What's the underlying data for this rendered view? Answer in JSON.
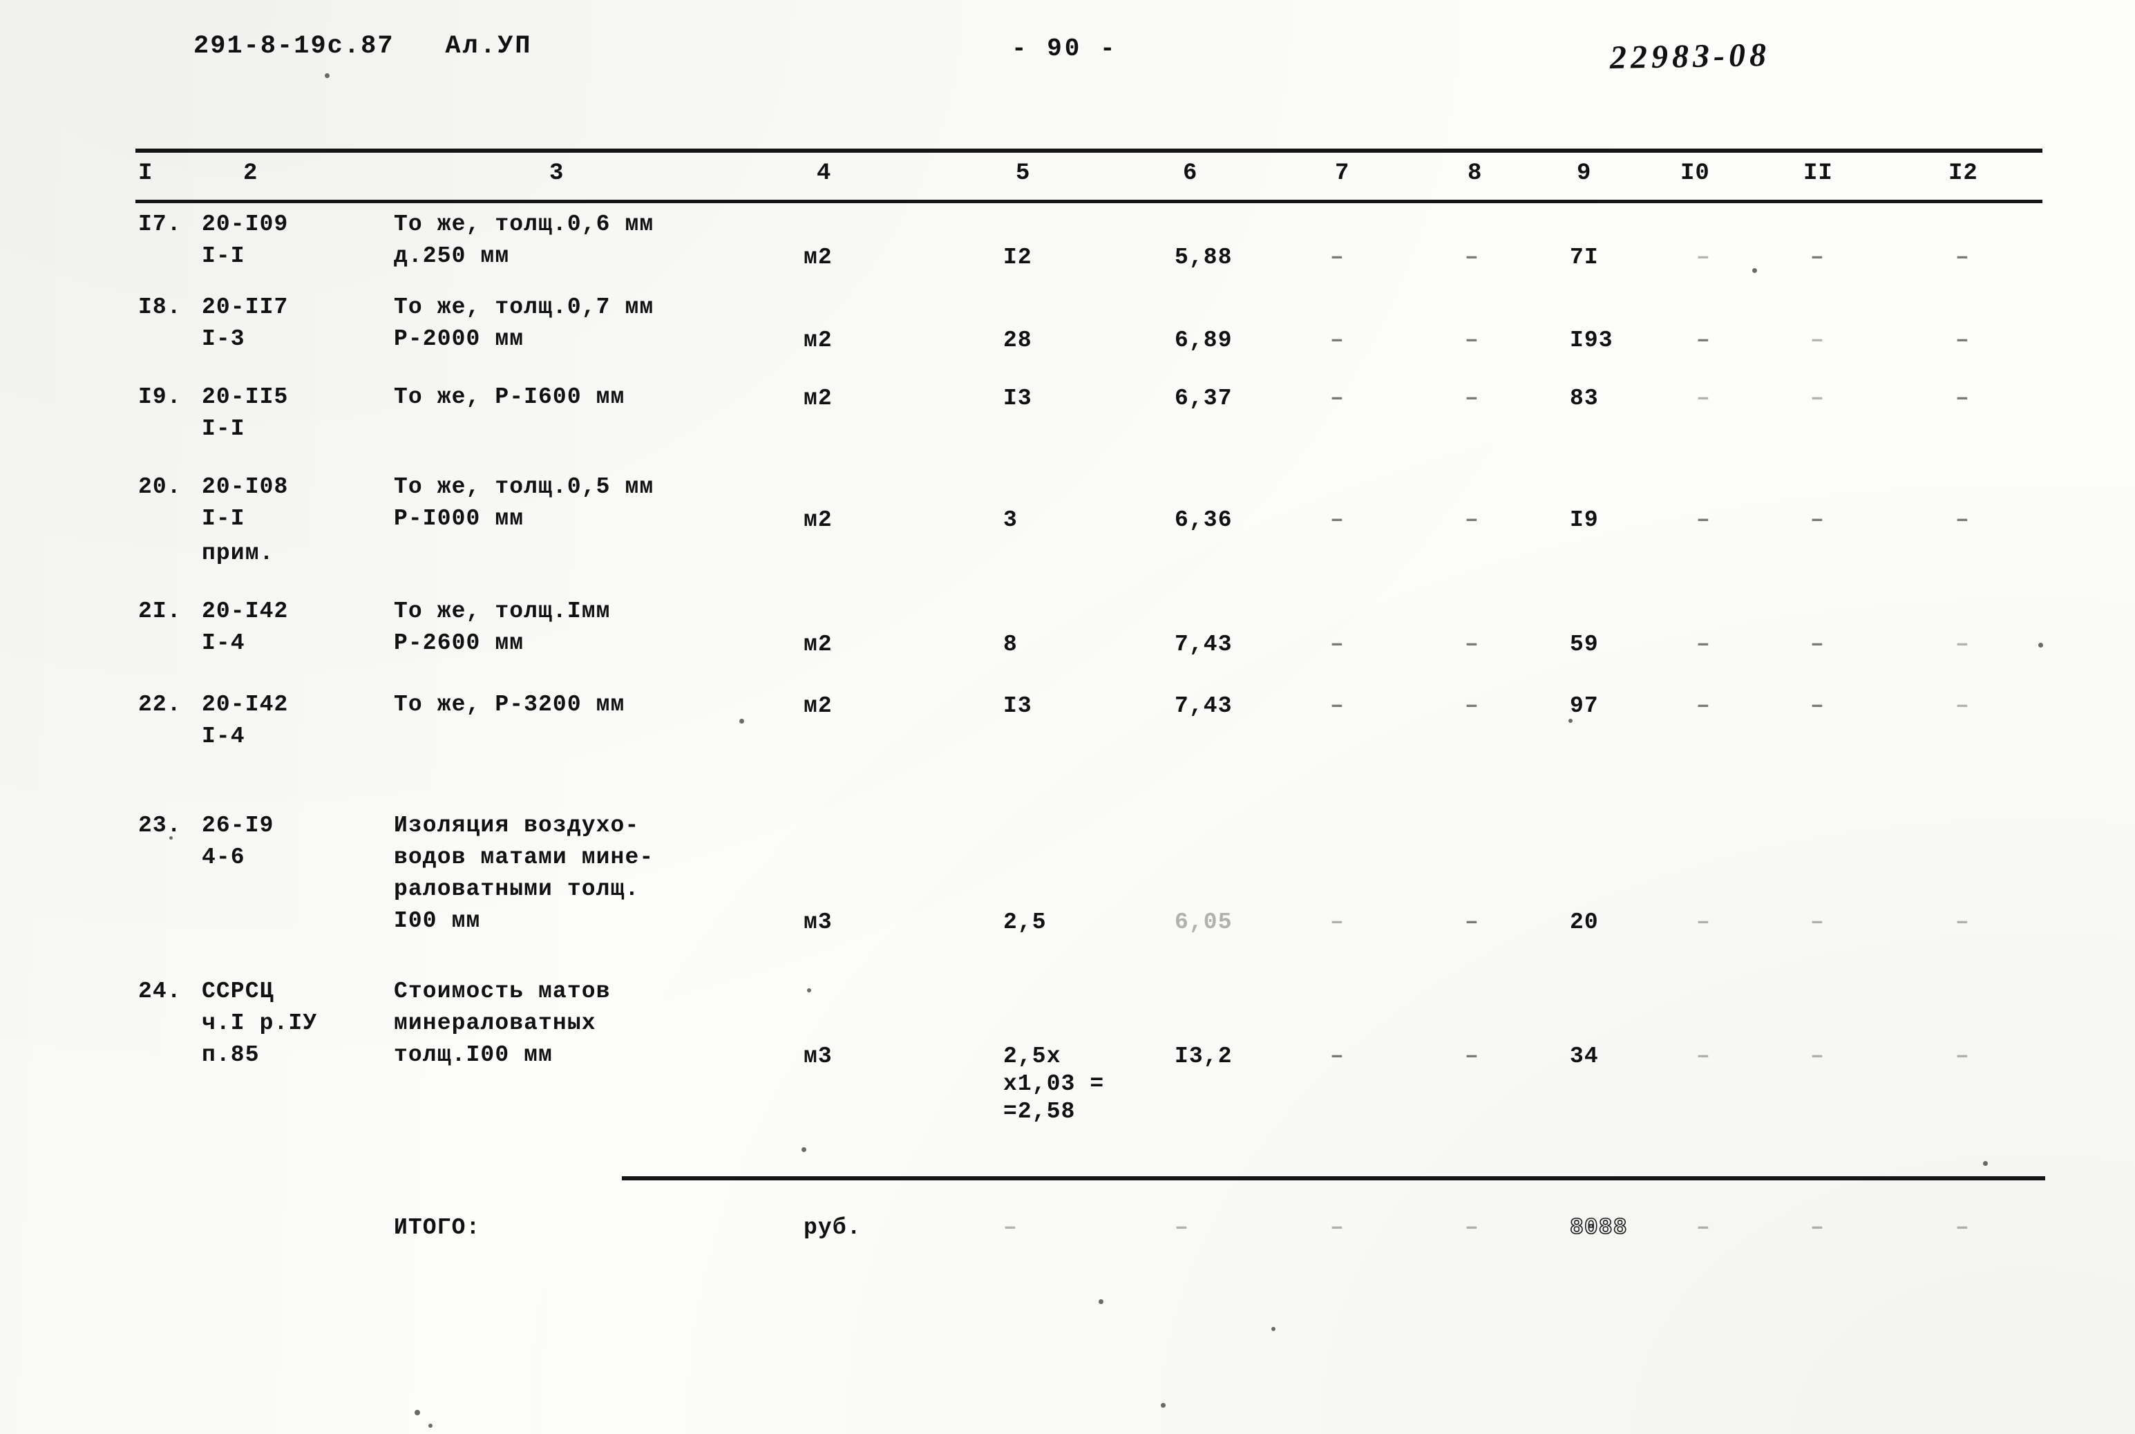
{
  "header": {
    "doc_code": "291-8-19с.87",
    "album": "Ал.УП",
    "page_label": "- 90 -",
    "archive_code": "22983-08"
  },
  "table": {
    "column_headers": [
      "I",
      "2",
      "3",
      "4",
      "5",
      "6",
      "7",
      "8",
      "9",
      "I0",
      "II",
      "I2"
    ],
    "dash": "–",
    "rows": [
      {
        "num": "I7.",
        "code_line1": "20-I09",
        "code_line2": "I-I",
        "code_line3": "",
        "desc_line1": "То же, толщ.0,6 мм",
        "desc_line2": "д.250 мм",
        "desc_line3": "",
        "desc_line4": "",
        "unit": "м2",
        "qty": "I2",
        "price": "5,88",
        "c7": "–",
        "c8": "–",
        "c9": "7I",
        "c10": "–",
        "c11": "–",
        "c12": "–"
      },
      {
        "num": "I8.",
        "code_line1": "20-II7",
        "code_line2": "I-3",
        "code_line3": "",
        "desc_line1": "То же, толщ.0,7 мм",
        "desc_line2": "Р-2000 мм",
        "desc_line3": "",
        "desc_line4": "",
        "unit": "м2",
        "qty": "28",
        "price": "6,89",
        "c7": "–",
        "c8": "–",
        "c9": "I93",
        "c10": "–",
        "c11": "–",
        "c12": "–"
      },
      {
        "num": "I9.",
        "code_line1": "20-II5",
        "code_line2": "I-I",
        "code_line3": "",
        "desc_line1": "То же, Р-I600 мм",
        "desc_line2": "",
        "desc_line3": "",
        "desc_line4": "",
        "unit": "м2",
        "qty": "I3",
        "price": "6,37",
        "c7": "–",
        "c8": "–",
        "c9": "83",
        "c10": "–",
        "c11": "–",
        "c12": "–"
      },
      {
        "num": "20.",
        "code_line1": "20-I08",
        "code_line2": "I-I",
        "code_line3": "прим.",
        "desc_line1": "То же, толщ.0,5 мм",
        "desc_line2": "Р-I000 мм",
        "desc_line3": "",
        "desc_line4": "",
        "unit": "м2",
        "qty": "3",
        "price": "6,36",
        "c7": "–",
        "c8": "–",
        "c9": "I9",
        "c10": "–",
        "c11": "–",
        "c12": "–"
      },
      {
        "num": "2I.",
        "code_line1": "20-I42",
        "code_line2": "I-4",
        "code_line3": "",
        "desc_line1": "То же, толщ.Iмм",
        "desc_line2": "Р-2600 мм",
        "desc_line3": "",
        "desc_line4": "",
        "unit": "м2",
        "qty": "8",
        "price": "7,43",
        "c7": "–",
        "c8": "–",
        "c9": "59",
        "c10": "–",
        "c11": "–",
        "c12": "–"
      },
      {
        "num": "22.",
        "code_line1": "20-I42",
        "code_line2": "I-4",
        "code_line3": "",
        "desc_line1": "То же, Р-3200 мм",
        "desc_line2": "",
        "desc_line3": "",
        "desc_line4": "",
        "unit": "м2",
        "qty": "I3",
        "price": "7,43",
        "c7": "–",
        "c8": "–",
        "c9": "97",
        "c10": "–",
        "c11": "–",
        "c12": "–"
      },
      {
        "num": "23.",
        "code_line1": "26-I9",
        "code_line2": "4-6",
        "code_line3": "",
        "desc_line1": "Изоляция воздухо-",
        "desc_line2": "водов матами мине-",
        "desc_line3": "раловатными толщ.",
        "desc_line4": "I00 мм",
        "unit": "м3",
        "qty": "2,5",
        "price": "6,05",
        "c7": "–",
        "c8": "–",
        "c9": "20",
        "c10": "–",
        "c11": "–",
        "c12": "–"
      },
      {
        "num": "24.",
        "code_line1": "ССРСЦ",
        "code_line2": "ч.I р.IУ",
        "code_line3": "п.85",
        "desc_line1": "Стоимость матов",
        "desc_line2": "минераловатных",
        "desc_line3": "толщ.I00 мм",
        "desc_line4": "",
        "unit": "м3",
        "qty": "2,5х",
        "qty_line2": "х1,03 =",
        "qty_line3": "=2,58",
        "price": "I3,2",
        "c7": "–",
        "c8": "–",
        "c9": "34",
        "c10": "–",
        "c11": "–",
        "c12": "–"
      }
    ],
    "total_row": {
      "label": "ИТОГО:",
      "unit": "руб.",
      "qty": "–",
      "price": "–",
      "c7": "–",
      "c8": "–",
      "c9": "8088",
      "c10": "–",
      "c11": "–",
      "c12": "–"
    }
  }
}
